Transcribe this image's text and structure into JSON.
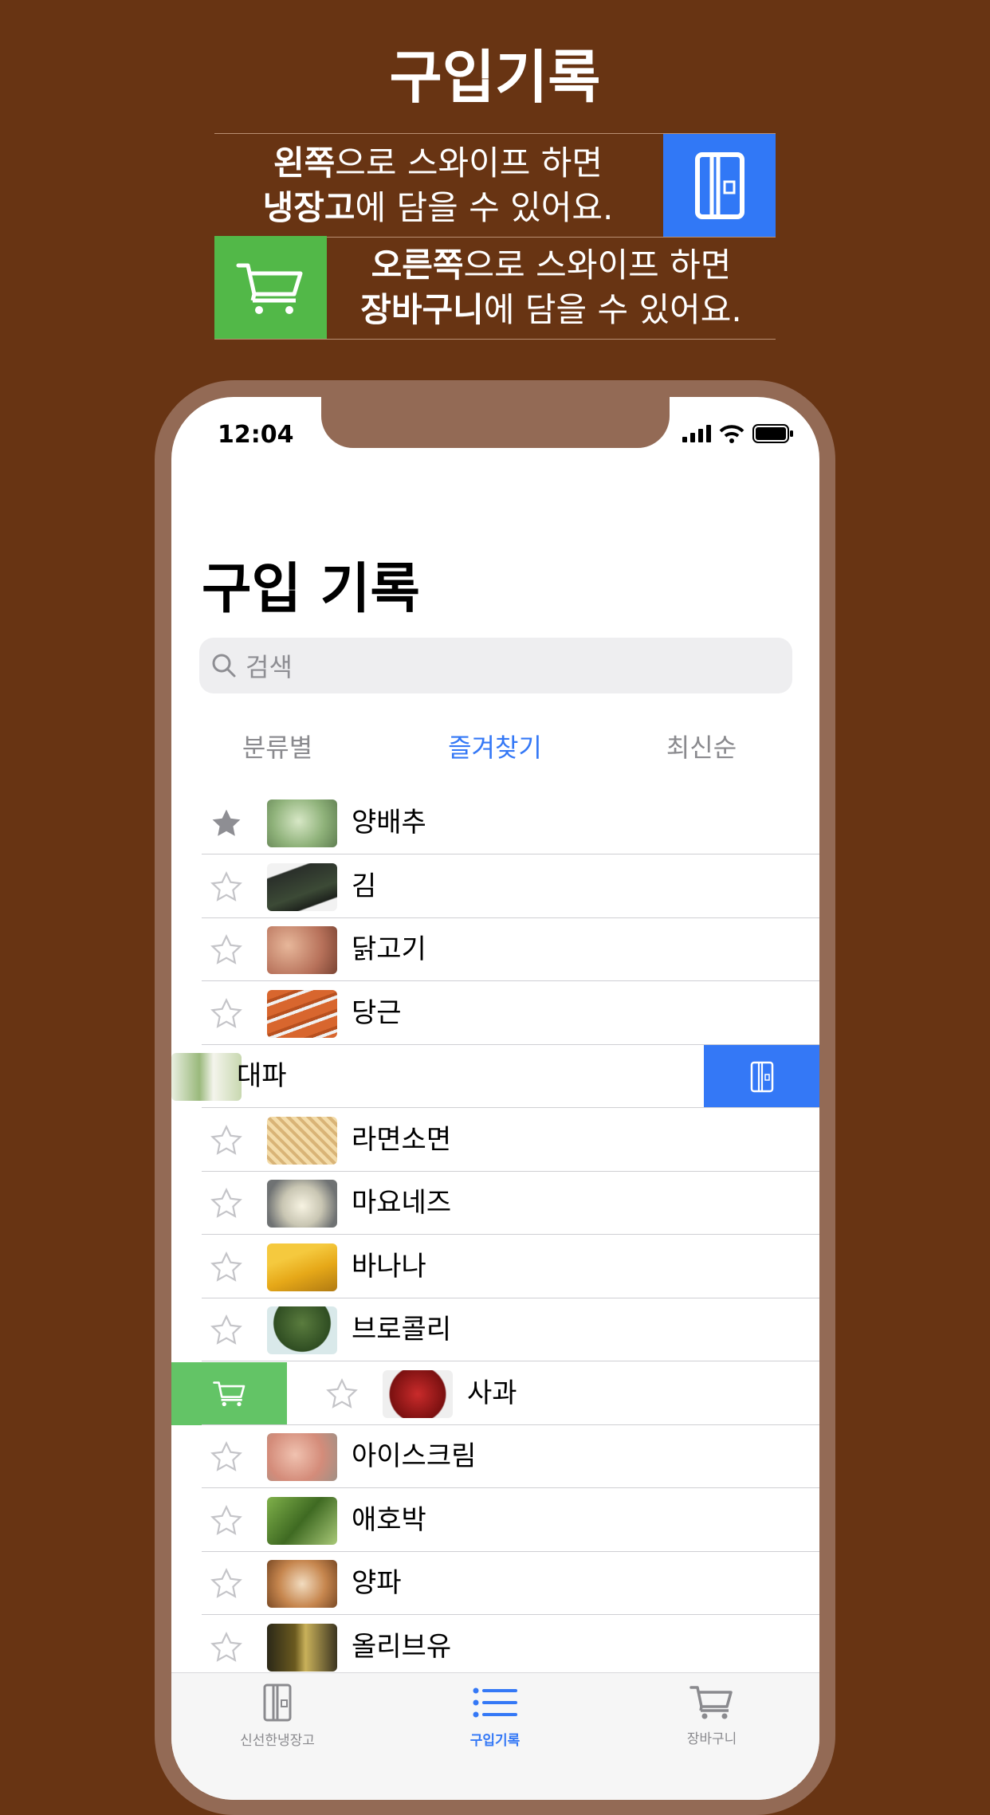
{
  "hero": {
    "title": "구입기록",
    "banner_left": {
      "line1_bold": "왼쪽",
      "line1_rest": "으로 스와이프 하면",
      "line2_bold": "냉장고",
      "line2_rest": "에 담을 수 있어요."
    },
    "banner_right": {
      "line1_bold": "오른쪽",
      "line1_rest": "으로 스와이프 하면",
      "line2_bold": "장바구니",
      "line2_rest": "에 담을 수 있어요."
    },
    "icons": {
      "fridge": "fridge-icon",
      "cart": "cart-icon"
    },
    "colors": {
      "background": "#683413",
      "fridge_blue": "#3178f6",
      "cart_green": "#52b848"
    }
  },
  "status": {
    "time": "12:04"
  },
  "screen": {
    "title": "구입 기록",
    "search_placeholder": "검색",
    "segments": [
      "분류별",
      "즐겨찾기",
      "최신순"
    ],
    "active_segment": "즐겨찾기"
  },
  "items": [
    {
      "name": "양배추",
      "favorite": true
    },
    {
      "name": "김",
      "favorite": false
    },
    {
      "name": "닭고기",
      "favorite": false
    },
    {
      "name": "당근",
      "favorite": false
    },
    {
      "name": "대파",
      "favorite": false,
      "swipe": "left"
    },
    {
      "name": "라면소면",
      "favorite": false
    },
    {
      "name": "마요네즈",
      "favorite": false
    },
    {
      "name": "바나나",
      "favorite": false
    },
    {
      "name": "브로콜리",
      "favorite": false
    },
    {
      "name": "사과",
      "favorite": false,
      "swipe": "right"
    },
    {
      "name": "아이스크림",
      "favorite": false
    },
    {
      "name": "애호박",
      "favorite": false
    },
    {
      "name": "양파",
      "favorite": false
    },
    {
      "name": "올리브유",
      "favorite": false
    }
  ],
  "tabbar": {
    "tabs": [
      {
        "label": "신선한냉장고",
        "icon": "fridge-icon"
      },
      {
        "label": "구입기록",
        "icon": "list-icon"
      },
      {
        "label": "장바구니",
        "icon": "cart-icon"
      }
    ],
    "active": "구입기록"
  }
}
